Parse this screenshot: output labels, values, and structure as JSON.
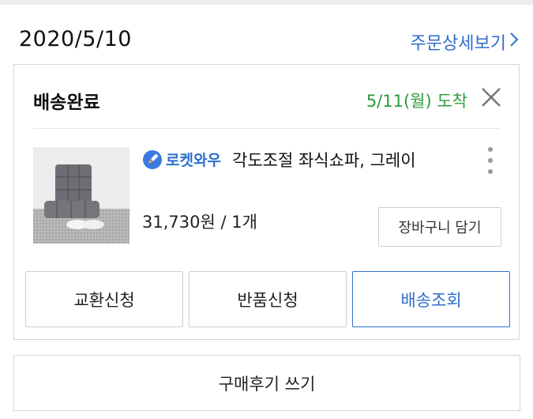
{
  "order": {
    "date": "2020/5/10",
    "detail_link": "주문상세보기"
  },
  "shipment": {
    "status": "배송완료",
    "arrival": "5/11(월) 도착"
  },
  "product": {
    "badge": "로켓와우",
    "name": "각도조절 좌식쇼파, 그레이",
    "price_qty": "31,730원 / 1개",
    "add_to_cart": "장바구니 담기"
  },
  "actions": {
    "exchange": "교환신청",
    "return": "반품신청",
    "track": "배송조회"
  },
  "review_button": "구매후기 쓰기",
  "colors": {
    "link_blue": "#2f6fcb",
    "arrival_green": "#2b9b3a",
    "border": "#d6d6d6"
  },
  "icons": [
    "chevron-right-icon",
    "close-icon",
    "rocket-icon",
    "more-options-icon"
  ]
}
